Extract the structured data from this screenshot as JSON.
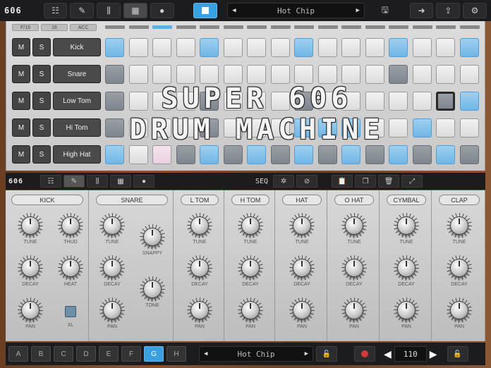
{
  "app": {
    "logo": "606"
  },
  "topbar": {
    "preset_name": "Hot Chip",
    "icons": [
      "pattern-list-icon",
      "edit-wrench-icon",
      "mixer-icon",
      "grid-icon",
      "bomb-icon"
    ],
    "stop_color": "#3aa0e0"
  },
  "sequencer": {
    "top_buttons": [
      "F/16",
      "16",
      "ACC"
    ],
    "rows": [
      {
        "mute": "M",
        "solo": "S",
        "name": "Kick",
        "steps": [
          1,
          0,
          0,
          0,
          1,
          0,
          0,
          0,
          1,
          0,
          0,
          0,
          1,
          0,
          0,
          1
        ]
      },
      {
        "mute": "M",
        "solo": "S",
        "name": "Snare",
        "steps": [
          2,
          0,
          0,
          0,
          0,
          0,
          0,
          0,
          0,
          0,
          0,
          0,
          2,
          0,
          0,
          0
        ]
      },
      {
        "mute": "M",
        "solo": "S",
        "name": "Low Tom",
        "steps": [
          2,
          0,
          0,
          0,
          2,
          0,
          0,
          0,
          2,
          0,
          0,
          0,
          0,
          0,
          4,
          1
        ]
      },
      {
        "mute": "M",
        "solo": "S",
        "name": "Hi Tom",
        "steps": [
          2,
          0,
          0,
          0,
          2,
          0,
          0,
          0,
          1,
          1,
          1,
          0,
          0,
          1,
          0,
          0
        ]
      },
      {
        "mute": "M",
        "solo": "S",
        "name": "High Hat",
        "steps": [
          1,
          0,
          3,
          2,
          1,
          2,
          1,
          2,
          1,
          2,
          1,
          2,
          1,
          2,
          1,
          2
        ]
      }
    ],
    "overlay_title_line1": "SUPER 606",
    "overlay_title_line2": "DRUM MACHINE"
  },
  "bar2": {
    "logo": "606",
    "seq_label": "SEQ"
  },
  "synth": {
    "channels": [
      {
        "name": "KICK"
      },
      {
        "name": "SNARE"
      },
      {
        "name": "L TOM"
      },
      {
        "name": "H TOM"
      },
      {
        "name": "HAT"
      },
      {
        "name": "O HAT"
      },
      {
        "name": "CYMBAL"
      },
      {
        "name": "CLAP"
      }
    ],
    "labels": {
      "tune": "TUNE",
      "thud": "THUD",
      "decay": "DECAY",
      "heat": "HEAT",
      "pan": "PAN",
      "xl": "XL",
      "snappy": "SNAPPY",
      "tone": "TONE"
    }
  },
  "bottombar": {
    "patterns": [
      "A",
      "B",
      "C",
      "D",
      "E",
      "F",
      "G",
      "H"
    ],
    "active_pattern": "G",
    "preset_name": "Hot Chip",
    "bpm": "110"
  }
}
